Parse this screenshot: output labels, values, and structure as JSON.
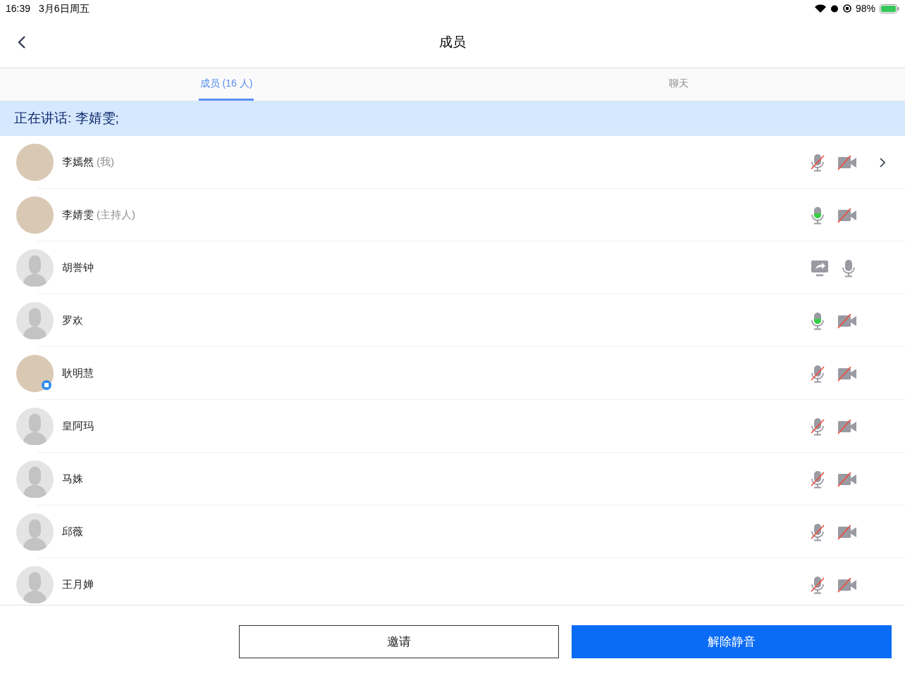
{
  "status_bar": {
    "time": "16:39",
    "date": "3月6日周五",
    "battery": "98%"
  },
  "nav": {
    "title": "成员"
  },
  "tabs": [
    {
      "label": "成员 (16 人)",
      "selected": true
    },
    {
      "label": "聊天",
      "selected": false
    }
  ],
  "speaking_banner": "正在讲话: 李婧雯;",
  "members": [
    {
      "name": "李嫣然",
      "role": "(我)",
      "has_photo": true,
      "badge": false,
      "icons": [
        {
          "kind": "mic-muted"
        },
        {
          "kind": "camera-off"
        }
      ],
      "has_detail": true
    },
    {
      "name": "李婧雯",
      "role": "(主持人)",
      "has_photo": true,
      "badge": false,
      "icons": [
        {
          "kind": "mic-active"
        },
        {
          "kind": "camera-off"
        }
      ],
      "has_detail": false
    },
    {
      "name": "胡誉钟",
      "has_photo": false,
      "badge": false,
      "icons": [
        {
          "kind": "screen-share"
        },
        {
          "kind": "mic-on"
        }
      ],
      "has_detail": false
    },
    {
      "name": "罗欢",
      "has_photo": false,
      "badge": false,
      "icons": [
        {
          "kind": "mic-active"
        },
        {
          "kind": "camera-off"
        }
      ],
      "has_detail": false
    },
    {
      "name": "耿明慧",
      "has_photo": true,
      "badge": true,
      "icons": [
        {
          "kind": "mic-muted"
        },
        {
          "kind": "camera-off"
        }
      ],
      "has_detail": false
    },
    {
      "name": "皇阿玛",
      "has_photo": false,
      "badge": false,
      "icons": [
        {
          "kind": "mic-muted"
        },
        {
          "kind": "camera-off"
        }
      ],
      "has_detail": false
    },
    {
      "name": "马姝",
      "has_photo": false,
      "badge": false,
      "icons": [
        {
          "kind": "mic-muted"
        },
        {
          "kind": "camera-off"
        }
      ],
      "has_detail": false
    },
    {
      "name": "邱薇",
      "has_photo": false,
      "badge": false,
      "icons": [
        {
          "kind": "mic-muted"
        },
        {
          "kind": "camera-off"
        }
      ],
      "has_detail": false
    },
    {
      "name": "王月婵",
      "has_photo": false,
      "badge": false,
      "icons": [
        {
          "kind": "mic-muted"
        },
        {
          "kind": "camera-off"
        }
      ],
      "has_detail": false
    }
  ],
  "buttons": {
    "invite": "邀请",
    "unmute_all": "解除静音"
  }
}
